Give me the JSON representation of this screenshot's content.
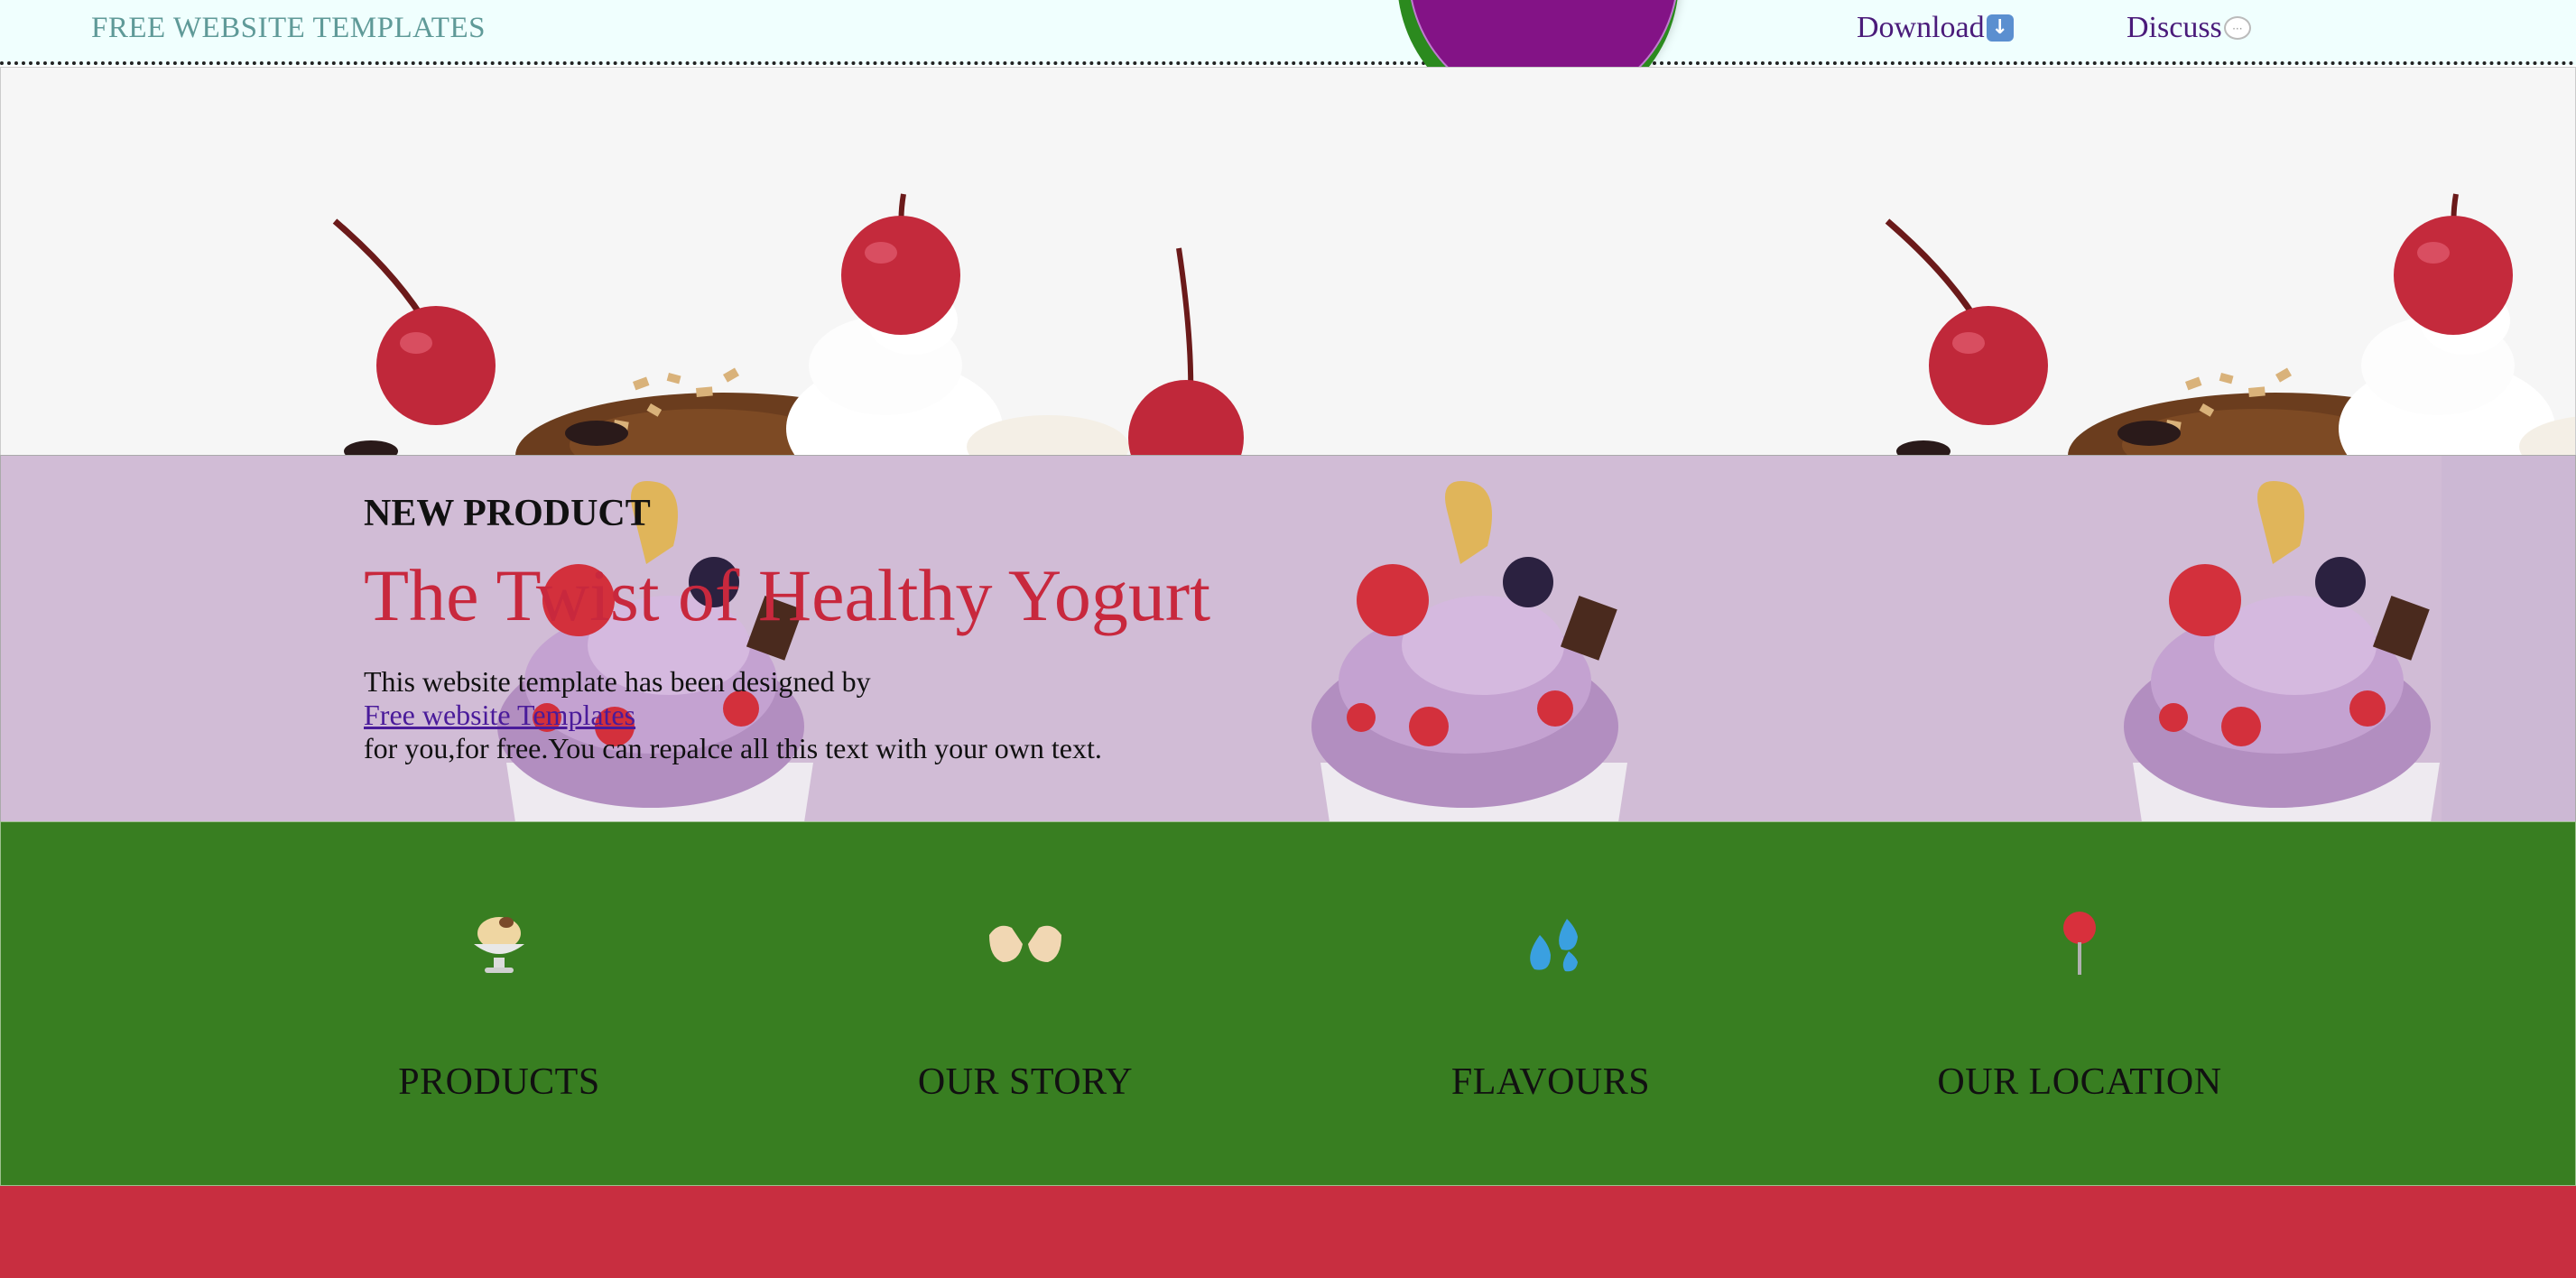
{
  "header": {
    "brand": "FREE WEBSITE TEMPLATES",
    "nav": [
      {
        "label": "Download",
        "icon": "download-arrow-icon"
      },
      {
        "label": "Discuss",
        "icon": "speech-bubble-icon"
      }
    ],
    "logo_color": "#831386"
  },
  "hero": {
    "image": "ice-cream-sundae-with-cherries-banner"
  },
  "promo": {
    "kicker": "NEW PRODUCT",
    "title": "The Twist of Healthy Yogurt",
    "body_before": "This website template has been designed by",
    "link": "Free website Templates",
    "body_after": "for you,for free.You can repalce all this text with your own text.",
    "image": "berry-frozen-yogurt-cup"
  },
  "features": [
    {
      "label": "PRODUCTS",
      "icon": "ice-cream-bowl-icon"
    },
    {
      "label": "OUR STORY",
      "icon": "open-hands-icon"
    },
    {
      "label": "FLAVOURS",
      "icon": "droplets-icon"
    },
    {
      "label": "OUR LOCATION",
      "icon": "map-pin-icon"
    }
  ],
  "colors": {
    "topbar": "#f0fffe",
    "brand_text": "#5f9a98",
    "nav_text": "#4a1b7a",
    "promo_title": "#c8283d",
    "features_bg": "#387e21",
    "footer_band": "#c82e40"
  }
}
